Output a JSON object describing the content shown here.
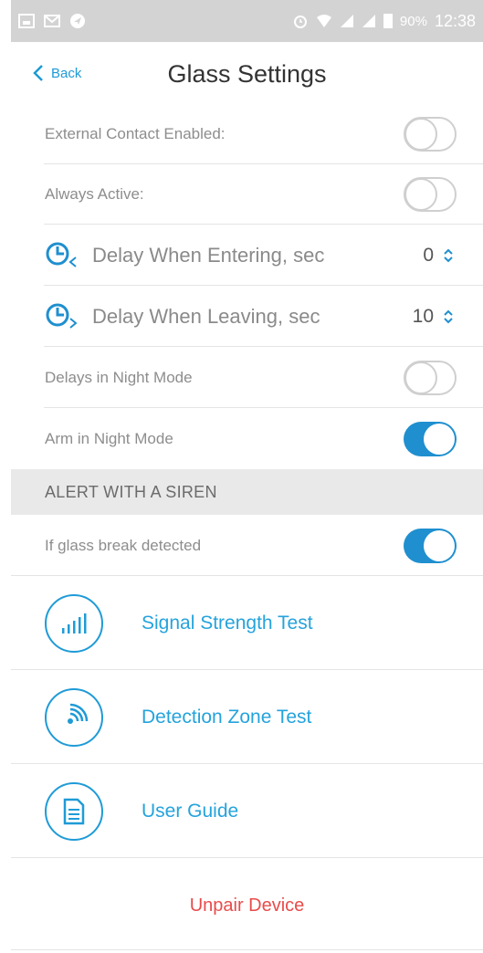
{
  "status_bar": {
    "battery_pct": "90%",
    "time": "12:38"
  },
  "nav": {
    "back_label": "Back",
    "title": "Glass Settings"
  },
  "settings": {
    "external_contact": {
      "label": "External Contact Enabled:",
      "on": false
    },
    "always_active": {
      "label": "Always Active:",
      "on": false
    },
    "delay_entering": {
      "label": "Delay When Entering, sec",
      "value": "0"
    },
    "delay_leaving": {
      "label": "Delay When Leaving, sec",
      "value": "10"
    },
    "delays_night": {
      "label": "Delays in Night Mode",
      "on": false
    },
    "arm_night": {
      "label": "Arm in Night Mode",
      "on": true
    }
  },
  "siren_section": {
    "header": "ALERT WITH A SIREN",
    "glass_break": {
      "label": "If glass break detected",
      "on": true
    }
  },
  "actions": {
    "signal_test": "Signal Strength Test",
    "zone_test": "Detection Zone Test",
    "user_guide": "User Guide"
  },
  "unpair": "Unpair Device",
  "colors": {
    "accent": "#1f8fcf",
    "danger": "#e94b4b",
    "section_bg": "#e9e9e9",
    "status_bar": "#d3d3d3"
  }
}
